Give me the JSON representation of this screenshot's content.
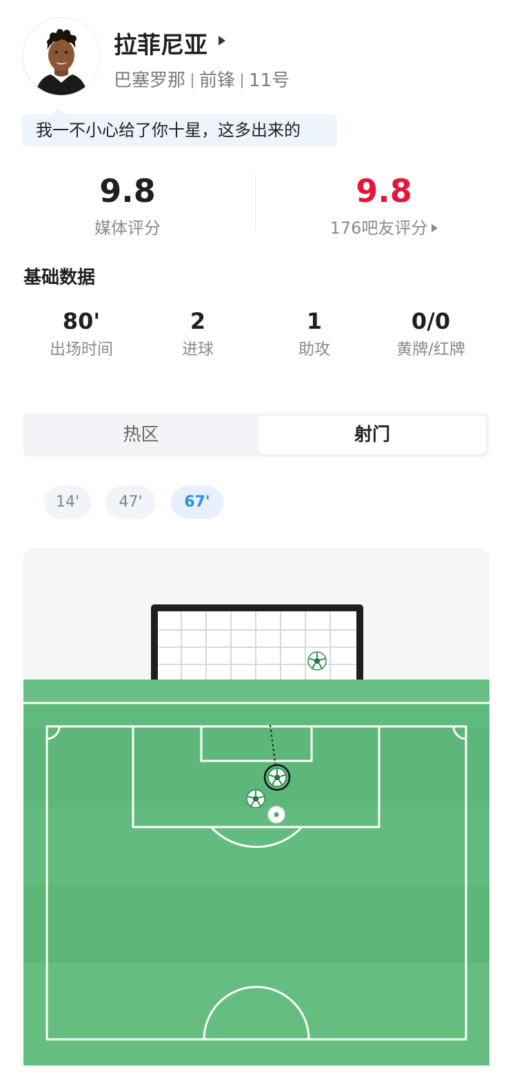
{
  "player": {
    "name": "拉菲尼亚",
    "club": "巴塞罗那",
    "position": "前锋",
    "number": "11号"
  },
  "comment": "我一不小心给了你十星，这多出来的",
  "ratings": {
    "media": {
      "value": "9.8",
      "label": "媒体评分"
    },
    "fans": {
      "value": "9.8",
      "label": "176吧友评分"
    }
  },
  "basic_stats": {
    "title": "基础数据",
    "items": [
      {
        "value": "80'",
        "label": "出场时间"
      },
      {
        "value": "2",
        "label": "进球"
      },
      {
        "value": "1",
        "label": "助攻"
      },
      {
        "value": "0/0",
        "label": "黄牌/红牌"
      }
    ]
  },
  "tabs": {
    "heat": "热区",
    "shot": "射门",
    "active": "射门"
  },
  "shot_times": [
    "14'",
    "47'",
    "67'"
  ],
  "selected_time": "67'",
  "colors": {
    "red_rating": "#e8153b",
    "accent_blue": "#2f8ee8",
    "pitch_green": "#5fba7d"
  }
}
